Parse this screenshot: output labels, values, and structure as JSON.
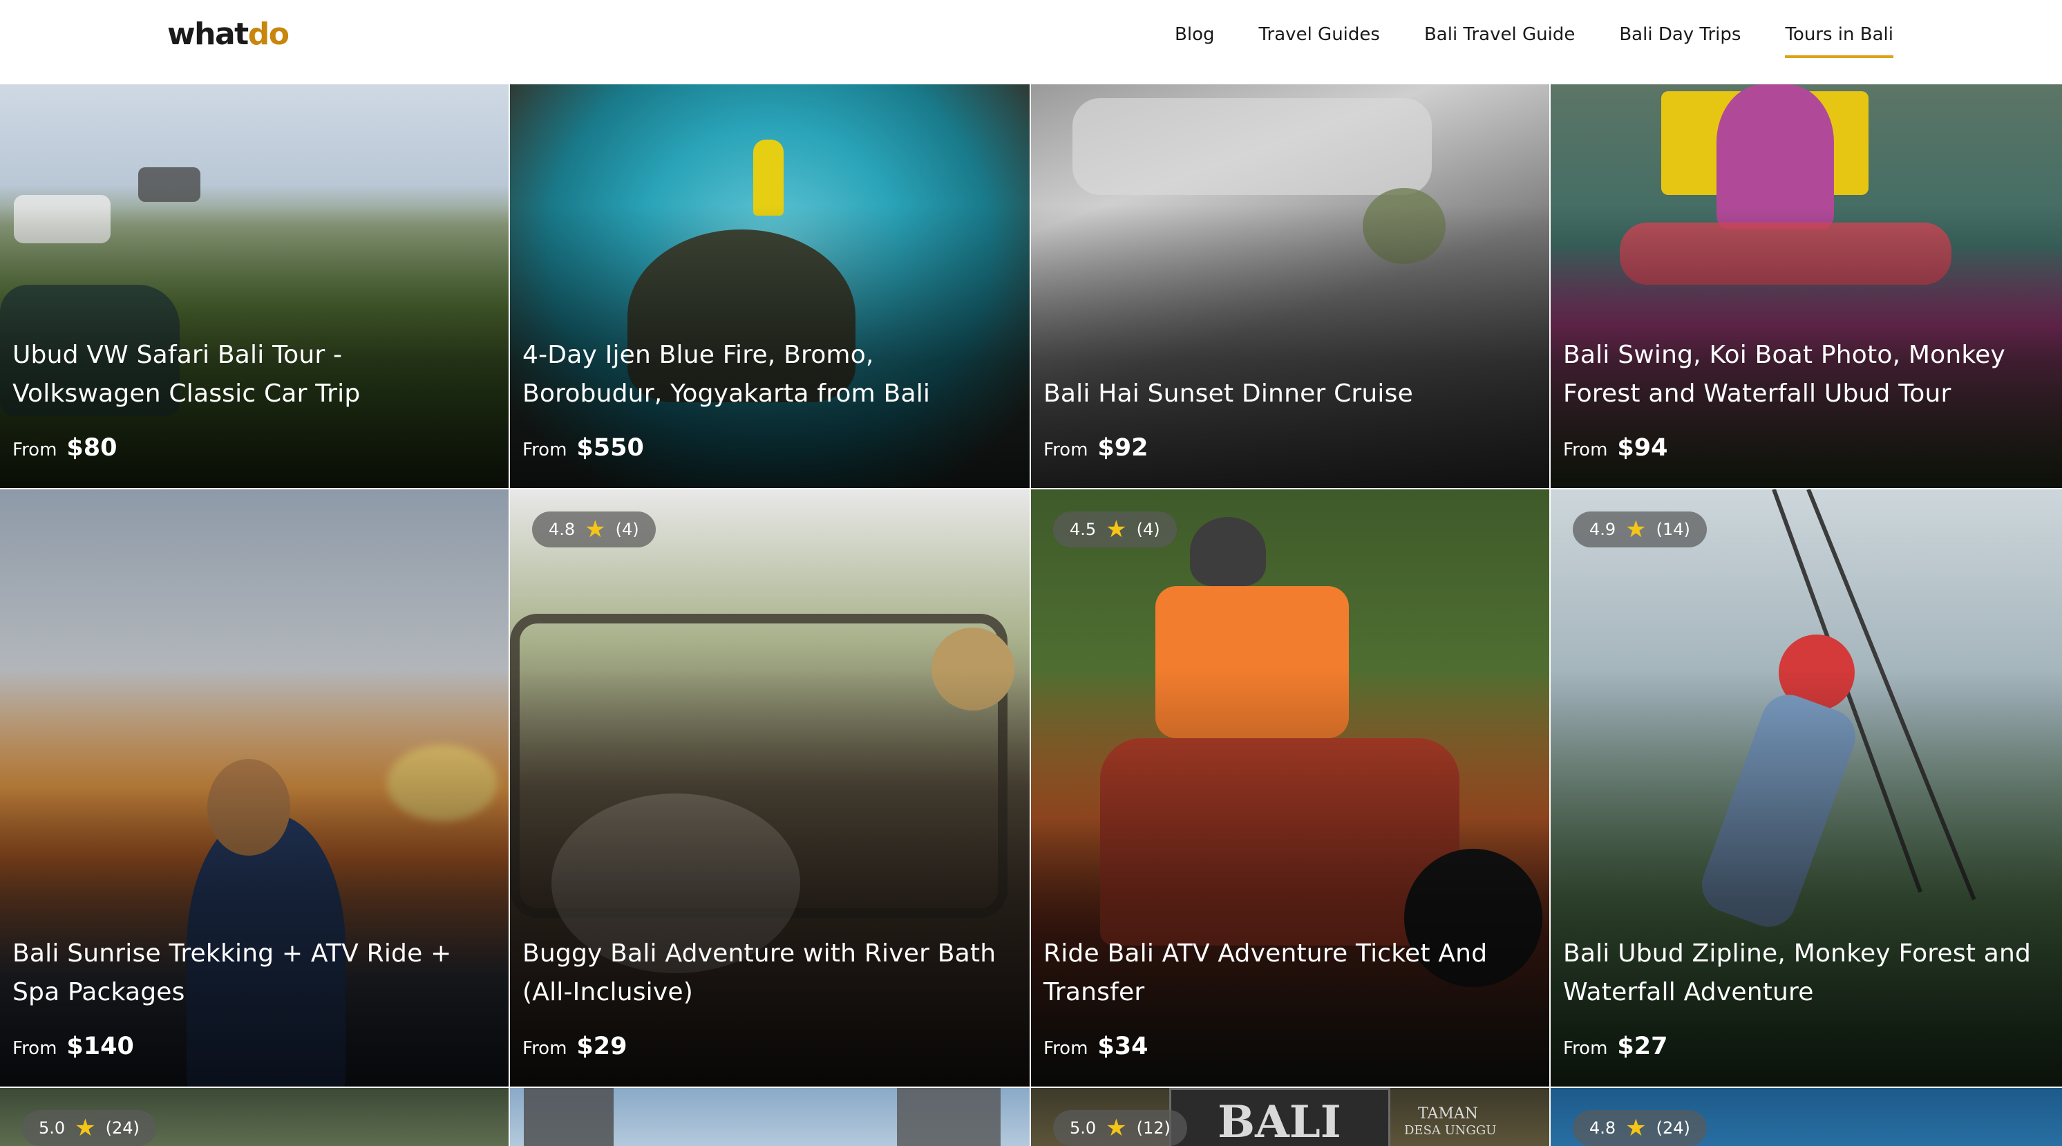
{
  "header": {
    "logo_part1": "what",
    "logo_part2": "do",
    "nav": [
      "Blog",
      "Travel Guides",
      "Bali Travel Guide",
      "Bali Day Trips",
      "Tours in Bali"
    ],
    "active_nav": "Tours in Bali"
  },
  "colors": {
    "accent": "#e0a21a",
    "logo_accent": "#c8860c"
  },
  "cards": [
    {
      "title": "Ubud VW Safari Bali Tour - Volkswagen Classic Car Trip",
      "from": "From",
      "price": "$80"
    },
    {
      "title": "4-Day Ijen Blue Fire, Bromo, Borobudur, Yogyakarta from Bali",
      "from": "From",
      "price": "$550"
    },
    {
      "title": "Bali Hai Sunset Dinner Cruise",
      "from": "From",
      "price": "$92"
    },
    {
      "title": "Bali Swing, Koi Boat Photo, Monkey Forest and Waterfall Ubud Tour",
      "from": "From",
      "price": "$94"
    },
    {
      "title": "Bali Sunrise Trekking + ATV Ride + Spa Packages",
      "from": "From",
      "price": "$140"
    },
    {
      "title": "Buggy Bali Adventure with River Bath (All-Inclusive)",
      "from": "From",
      "price": "$29",
      "rating": "4.8",
      "reviews": "(4)"
    },
    {
      "title": "Ride Bali ATV Adventure Ticket And Transfer",
      "from": "From",
      "price": "$34",
      "rating": "4.5",
      "reviews": "(4)"
    },
    {
      "title": "Bali Ubud Zipline, Monkey Forest and Waterfall Adventure",
      "from": "From",
      "price": "$27",
      "rating": "4.9",
      "reviews": "(14)"
    },
    {
      "rating": "5.0",
      "reviews": "(24)"
    },
    {},
    {
      "rating": "5.0",
      "reviews": "(12)",
      "sign_text": "BALI",
      "sign_text2": "TAMAN",
      "sign_text3": "DESA UNGGU"
    },
    {
      "rating": "4.8",
      "reviews": "(24)"
    }
  ]
}
